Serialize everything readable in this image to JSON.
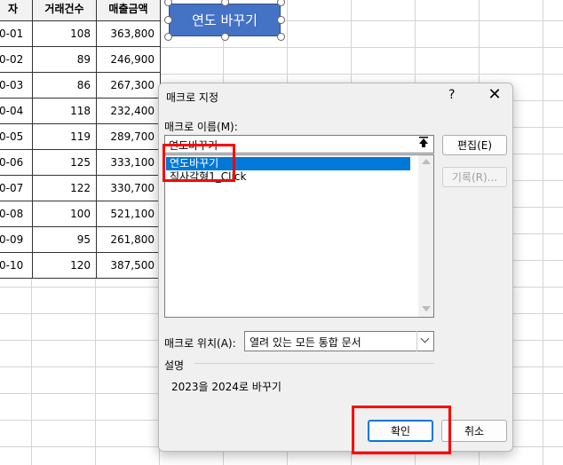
{
  "sheet": {
    "headers": [
      "자",
      "거래건수",
      "매출금액"
    ],
    "rows": [
      [
        "0-01",
        "108",
        "363,800"
      ],
      [
        "0-02",
        "89",
        "246,900"
      ],
      [
        "0-03",
        "86",
        "267,300"
      ],
      [
        "0-04",
        "118",
        "232,400"
      ],
      [
        "0-05",
        "119",
        "289,700"
      ],
      [
        "0-06",
        "125",
        "333,100"
      ],
      [
        "0-07",
        "122",
        "330,700"
      ],
      [
        "0-08",
        "100",
        "521,100"
      ],
      [
        "0-09",
        "95",
        "261,800"
      ],
      [
        "0-10",
        "120",
        "387,500"
      ]
    ]
  },
  "shape": {
    "label": "연도 바꾸기",
    "color": "#4472c4"
  },
  "dialog": {
    "title": "매크로 지정",
    "help": "?",
    "close": "✕",
    "name_label": "매크로 이름(M):",
    "name_value": "연도바꾸기",
    "list_items": [
      "연도바꾸기",
      "직사각형1_Click"
    ],
    "selected_index": 0,
    "edit_button": "편집(E)",
    "record_button": "기록(R)...",
    "location_label": "매크로 위치(A):",
    "location_value": "열려 있는 모든 통합 문서",
    "description_label": "설명",
    "description_text": "2023을 2024로 바꾸기",
    "ok_button": "확인",
    "cancel_button": "취소"
  },
  "colors": {
    "accent": "#0078d7",
    "highlight_box": "#ff0000"
  }
}
